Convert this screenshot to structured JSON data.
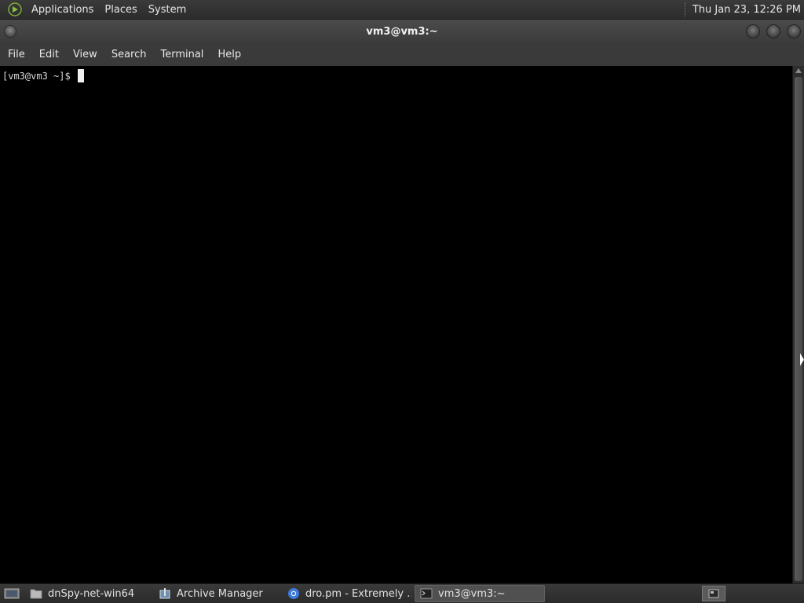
{
  "top_panel": {
    "menus": [
      "Applications",
      "Places",
      "System"
    ],
    "clock": "Thu Jan 23, 12:26 PM",
    "logo_icon": "mate-logo-icon"
  },
  "window": {
    "title": "vm3@vm3:~"
  },
  "menubar": {
    "items": [
      "File",
      "Edit",
      "View",
      "Search",
      "Terminal",
      "Help"
    ]
  },
  "terminal": {
    "prompt": "[vm3@vm3 ~]$ ",
    "background": "#000000",
    "foreground": "#d8d8d8"
  },
  "taskbar": {
    "tasks": [
      {
        "label": "dnSpy-net-win64",
        "icon": "folder-icon",
        "active": false
      },
      {
        "label": "Archive Manager",
        "icon": "archive-manager-icon",
        "active": false
      },
      {
        "label": "dro.pm - Extremely ...",
        "icon": "chrome-icon",
        "active": false
      },
      {
        "label": "vm3@vm3:~",
        "icon": "terminal-icon",
        "active": true
      }
    ]
  }
}
